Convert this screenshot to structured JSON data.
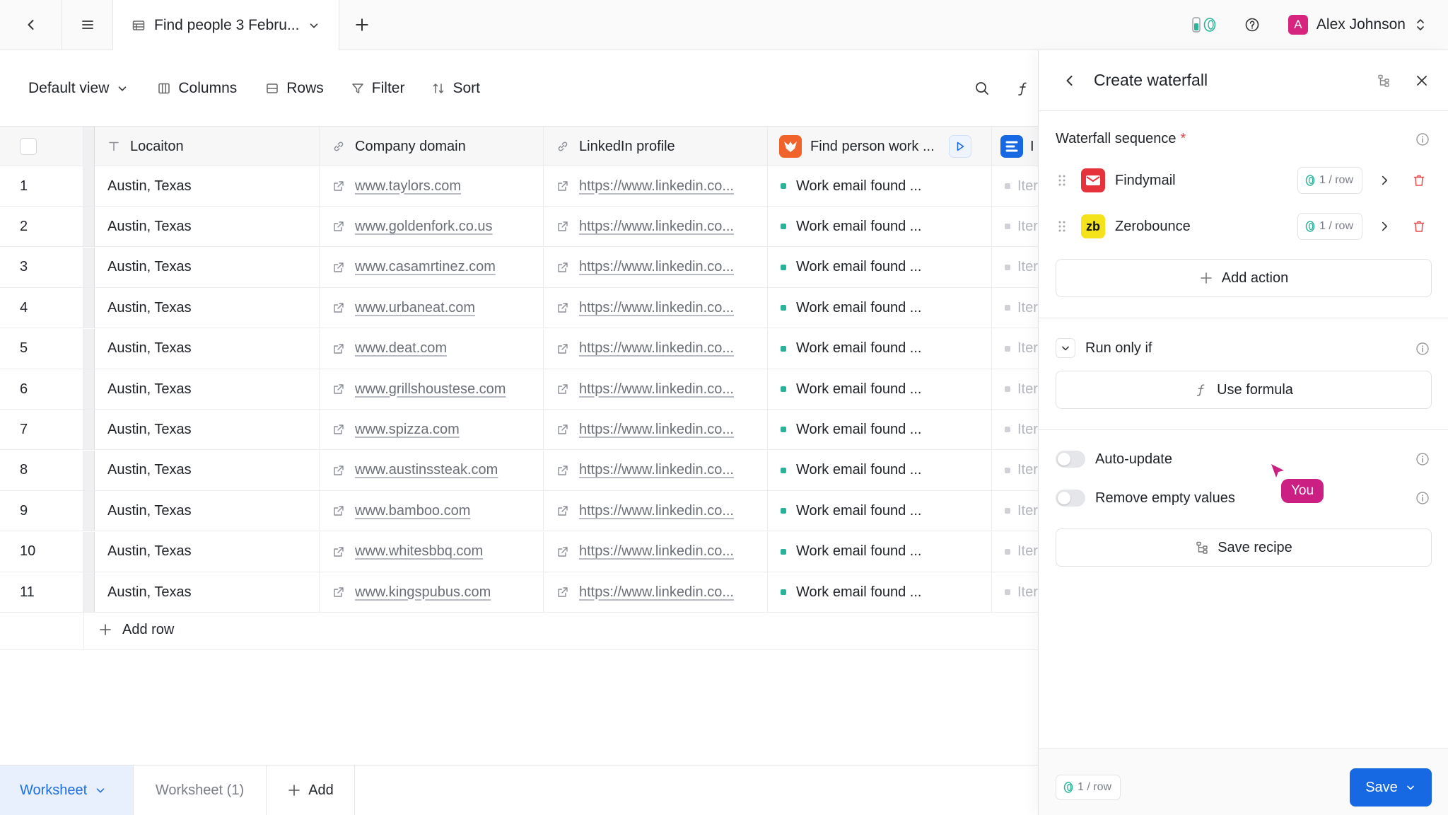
{
  "topbar": {
    "tab_title": "Find people 3 Febru...",
    "user_initial": "A",
    "user_name": "Alex Johnson"
  },
  "toolbar": {
    "view": "Default view",
    "columns": "Columns",
    "rows": "Rows",
    "filter": "Filter",
    "sort": "Sort"
  },
  "columns": {
    "location": "Locaiton",
    "company_domain": "Company domain",
    "linkedin": "LinkedIn profile",
    "find_person": "Find person work ...",
    "next": "I"
  },
  "rows": [
    {
      "num": "1",
      "location": "Austin, Texas",
      "domain": "www.taylors.com",
      "linkedin": "https://www.linkedin.co...",
      "status": "Work email found ...",
      "next": "Iter"
    },
    {
      "num": "2",
      "location": "Austin, Texas",
      "domain": "www.goldenfork.co.us",
      "linkedin": "https://www.linkedin.co...",
      "status": "Work email found ...",
      "next": "Iter"
    },
    {
      "num": "3",
      "location": "Austin, Texas",
      "domain": "www.casamrtinez.com",
      "linkedin": "https://www.linkedin.co...",
      "status": "Work email found ...",
      "next": "Iter"
    },
    {
      "num": "4",
      "location": "Austin, Texas",
      "domain": "www.urbaneat.com",
      "linkedin": "https://www.linkedin.co...",
      "status": "Work email found ...",
      "next": "Iter"
    },
    {
      "num": "5",
      "location": "Austin, Texas",
      "domain": "www.deat.com",
      "linkedin": "https://www.linkedin.co...",
      "status": "Work email found ...",
      "next": "Iter"
    },
    {
      "num": "6",
      "location": "Austin, Texas",
      "domain": "www.grillshoustese.com",
      "linkedin": "https://www.linkedin.co...",
      "status": "Work email found ...",
      "next": "Iter"
    },
    {
      "num": "7",
      "location": "Austin, Texas",
      "domain": "www.spizza.com",
      "linkedin": "https://www.linkedin.co...",
      "status": "Work email found ...",
      "next": "Iter"
    },
    {
      "num": "8",
      "location": "Austin, Texas",
      "domain": "www.austinssteak.com",
      "linkedin": "https://www.linkedin.co...",
      "status": "Work email found ...",
      "next": "Iter"
    },
    {
      "num": "9",
      "location": "Austin, Texas",
      "domain": "www.bamboo.com",
      "linkedin": "https://www.linkedin.co...",
      "status": "Work email found ...",
      "next": "Iter"
    },
    {
      "num": "10",
      "location": "Austin, Texas",
      "domain": "www.whitesbbq.com",
      "linkedin": "https://www.linkedin.co...",
      "status": "Work email found ...",
      "next": "Iter"
    },
    {
      "num": "11",
      "location": "Austin, Texas",
      "domain": "www.kingspubus.com",
      "linkedin": "https://www.linkedin.co...",
      "status": "Work email found ...",
      "next": "Iter"
    }
  ],
  "add_row": "Add row",
  "sheets": {
    "active": "Worksheet",
    "second": "Worksheet (1)",
    "add": "Add"
  },
  "panel": {
    "title": "Create waterfall",
    "sequence_title": "Waterfall sequence",
    "required_mark": "*",
    "providers": [
      {
        "name": "Findymail",
        "cost": "1 / row"
      },
      {
        "name": "Zerobounce",
        "cost": "1 / row",
        "logo_text": "zb"
      }
    ],
    "add_action": "Add action",
    "run_only_if": "Run only if",
    "use_formula": "Use formula",
    "auto_update": "Auto-update",
    "remove_empty": "Remove empty values",
    "save_recipe": "Save recipe",
    "cursor_label": "You",
    "footer_cost": "1 / row",
    "save": "Save"
  },
  "colors": {
    "accent": "#1668e3",
    "status_green": "#2bb39a",
    "cursor": "#cc1f83",
    "danger": "#e5484d"
  }
}
